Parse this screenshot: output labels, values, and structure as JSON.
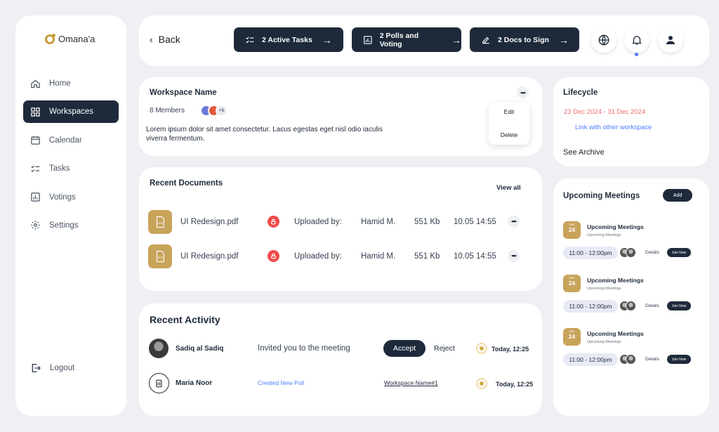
{
  "brand": {
    "name": "Omana'a"
  },
  "sidebar": {
    "items": [
      {
        "label": "Home",
        "icon": "home-icon",
        "active": false
      },
      {
        "label": "Workspaces",
        "icon": "grid-icon",
        "active": true
      },
      {
        "label": "Calendar",
        "icon": "calendar-icon",
        "active": false
      },
      {
        "label": "Tasks",
        "icon": "checklist-icon",
        "active": false
      },
      {
        "label": "Votings",
        "icon": "chart-icon",
        "active": false
      },
      {
        "label": "Settings",
        "icon": "gear-icon",
        "active": false
      }
    ],
    "logout_label": "Logout"
  },
  "topbar": {
    "back_label": "Back",
    "tasks_label": "2 Active Tasks",
    "polls_label": "2 Polls and Voting",
    "docs_label": "2 Docs to Sign"
  },
  "workspace": {
    "title": "Workspace Name",
    "members": "8 Members",
    "more_members": "+6",
    "description": "Lorem ipsum dolor sit amet consectetur. Lacus egestas eget nisl odio iaculis viverra fermentum.",
    "menu": {
      "edit": "Edit",
      "delete": "Delete"
    }
  },
  "lifecycle": {
    "title": "Lifecycle",
    "dates": "23 Dec 2024 - 31 Dec 2024",
    "link": "Link with other workspace",
    "archive": "See Archive"
  },
  "documents": {
    "title": "Recent Documents",
    "view_all": "View all",
    "rows": [
      {
        "name": "UI Redesign.pdf",
        "uploaded_label": "Uploaded by:",
        "uploader": "Hamid M.",
        "size": "551 Kb",
        "date": "10.05 14:55",
        "pdf_text": "PDF"
      },
      {
        "name": "UI Redesign.pdf",
        "uploaded_label": "Uploaded by:",
        "uploader": "Hamid M.",
        "size": "551 Kb",
        "date": "10.05 14:55",
        "pdf_text": "PDF"
      }
    ]
  },
  "activity": {
    "title": "Recent Activity",
    "rows": [
      {
        "name": "Sadiq al Sadiq",
        "text": "Invited you to the meeting",
        "accept": "Accept",
        "reject": "Reject",
        "time": "Today, 12:25"
      },
      {
        "name": "Maria Noor",
        "text": "Created New Poll",
        "link": "Workspace Name#1",
        "time": "Today, 12:25"
      }
    ]
  },
  "meetings": {
    "title": "Upcoming Meetings",
    "add_label": "Add",
    "items": [
      {
        "month": "Dec",
        "day": "24",
        "name": "Upcoming Meetings",
        "sub": "Upcoming Meetings",
        "time": "11:00 - 12:00pm",
        "details": "Details",
        "join": "Join Now"
      },
      {
        "month": "Dec",
        "day": "24",
        "name": "Upcoming Meetings",
        "sub": "Upcoming Meetings",
        "time": "11:00 - 12:00pm",
        "details": "Details",
        "join": "Join Now"
      },
      {
        "month": "Dec",
        "day": "24",
        "name": "Upcoming Meetings",
        "sub": "Upcoming Meetings",
        "time": "11:00 - 12:00pm",
        "details": "Details",
        "join": "Join Now"
      }
    ]
  },
  "colors": {
    "navy": "#1e2a3a",
    "gold": "#c8a35a",
    "red": "#ef4b4b",
    "link_blue": "#4f7cff",
    "date_red": "#ef6b6b"
  }
}
